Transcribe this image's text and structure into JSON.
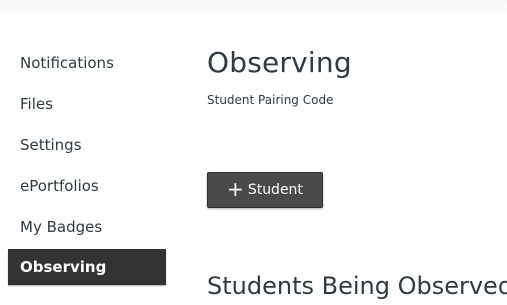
{
  "nav": {
    "items": [
      {
        "label": "Notifications"
      },
      {
        "label": "Files"
      },
      {
        "label": "Settings"
      },
      {
        "label": "ePortfolios"
      },
      {
        "label": "My Badges"
      },
      {
        "label": "Observing"
      }
    ],
    "active": "Observing"
  },
  "main": {
    "title": "Observing",
    "pairing_label": "Student Pairing Code",
    "add_button": {
      "icon": "plus-icon",
      "label": "Student"
    },
    "section_heading": "Students Being Observed"
  },
  "colors": {
    "active_nav_bg": "#333333",
    "button_bg": "#4a4a4a",
    "text": "#2d3b45"
  }
}
